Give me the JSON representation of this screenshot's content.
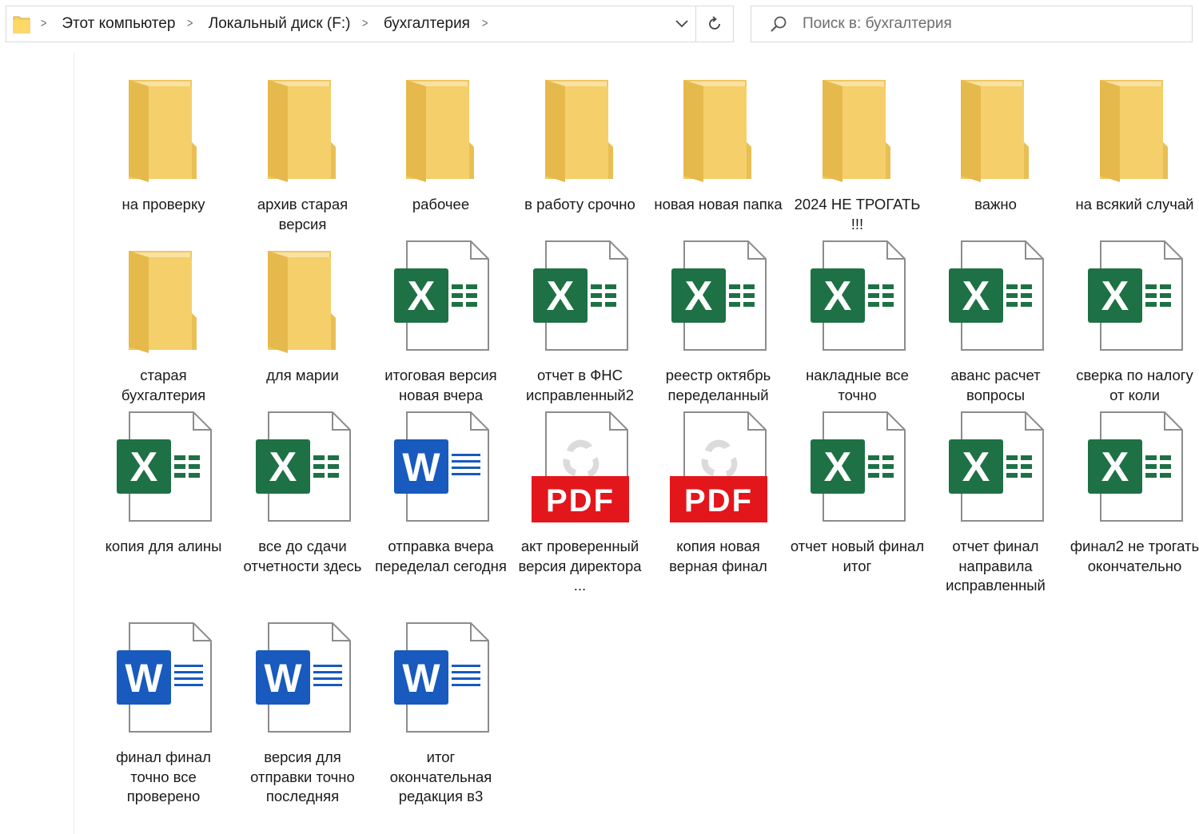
{
  "address": {
    "crumbs": [
      "Этот компьютер",
      "Локальный диск (F:)",
      "бухгалтерия"
    ]
  },
  "search": {
    "placeholder": "Поиск в: бухгалтерия"
  },
  "colors": {
    "folder": "#f5cf6a",
    "excel": "#1e7145",
    "word": "#185abd",
    "pdf": "#e3161c"
  },
  "items": [
    {
      "type": "folder",
      "name": "на проверку"
    },
    {
      "type": "folder",
      "name": "архив старая версия"
    },
    {
      "type": "folder",
      "name": "рабочее"
    },
    {
      "type": "folder",
      "name": "в работу срочно"
    },
    {
      "type": "folder",
      "name": "новая новая папка"
    },
    {
      "type": "folder",
      "name": "2024 НЕ ТРОГАТЬ !!!"
    },
    {
      "type": "folder",
      "name": "важно"
    },
    {
      "type": "folder",
      "name": "на всякий случай"
    },
    {
      "type": "folder",
      "name": "старая бухгалтерия"
    },
    {
      "type": "folder",
      "name": "для марии"
    },
    {
      "type": "excel",
      "name": "итоговая версия новая вчера"
    },
    {
      "type": "excel",
      "name": "отчет в ФНС исправленный2"
    },
    {
      "type": "excel",
      "name": "реестр октябрь переделанный"
    },
    {
      "type": "excel",
      "name": "накладные все точно"
    },
    {
      "type": "excel",
      "name": "аванс расчет вопросы"
    },
    {
      "type": "excel",
      "name": "сверка по налогу от коли"
    },
    {
      "type": "excel",
      "name": "копия для алины"
    },
    {
      "type": "excel",
      "name": "все до сдачи отчетности здесь"
    },
    {
      "type": "word",
      "name": "отправка вчера переделал сегодня"
    },
    {
      "type": "pdf",
      "name": "акт проверенный версия директора ..."
    },
    {
      "type": "pdf",
      "name": "копия новая верная финал"
    },
    {
      "type": "excel",
      "name": "отчет новый финал итог"
    },
    {
      "type": "excel",
      "name": "отчет финал направила исправленный"
    },
    {
      "type": "excel",
      "name": "финал2 не трогать окончательно"
    },
    {
      "type": "word",
      "name": "финал финал точно все проверено"
    },
    {
      "type": "word",
      "name": "версия для отправки точно последняя"
    },
    {
      "type": "word",
      "name": "итог окончательная редакция в3"
    }
  ]
}
